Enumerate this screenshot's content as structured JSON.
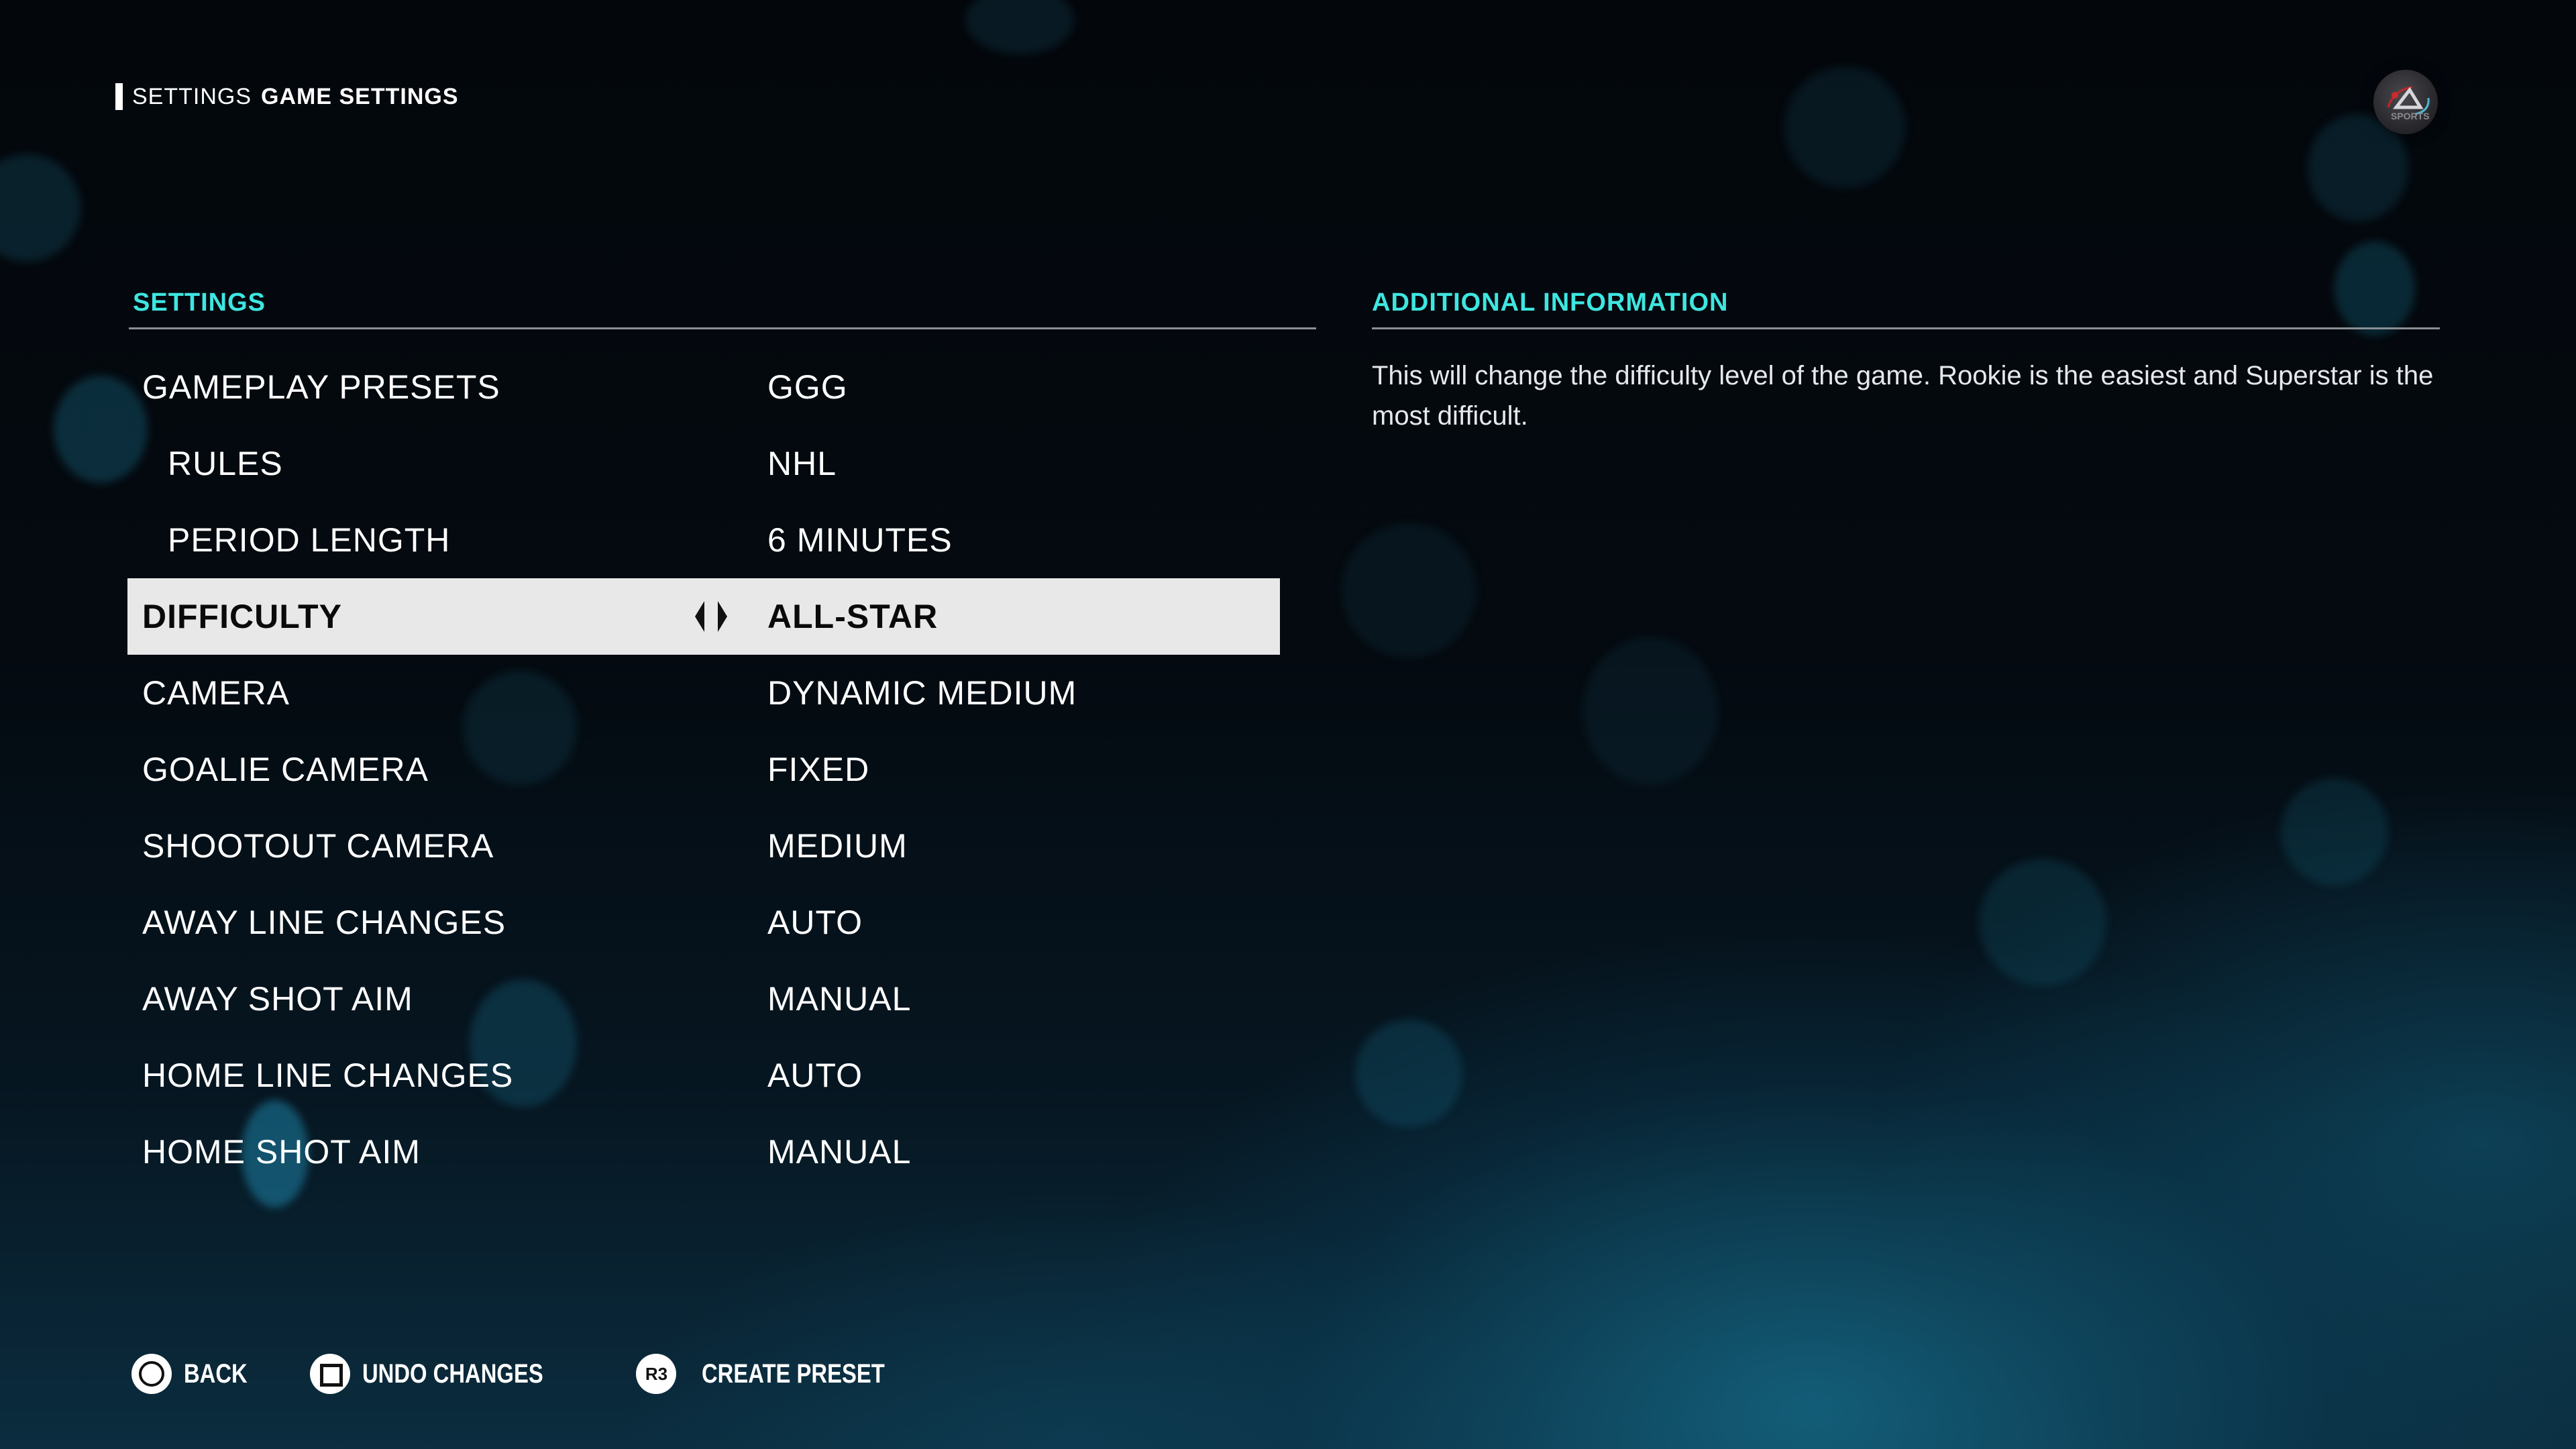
{
  "header": {
    "breadcrumb_parent": "SETTINGS",
    "breadcrumb_current": "GAME SETTINGS",
    "logo": "ea-sports-logo"
  },
  "settings_panel": {
    "heading": "SETTINGS",
    "rows": [
      {
        "label": "GAMEPLAY PRESETS",
        "value": "GGG",
        "indent": false,
        "selected": false
      },
      {
        "label": "RULES",
        "value": "NHL",
        "indent": true,
        "selected": false
      },
      {
        "label": "PERIOD LENGTH",
        "value": "6 MINUTES",
        "indent": true,
        "selected": false
      },
      {
        "label": "DIFFICULTY",
        "value": "ALL-STAR",
        "indent": false,
        "selected": true
      },
      {
        "label": "CAMERA",
        "value": "DYNAMIC MEDIUM",
        "indent": false,
        "selected": false
      },
      {
        "label": "GOALIE CAMERA",
        "value": "FIXED",
        "indent": false,
        "selected": false
      },
      {
        "label": "SHOOTOUT CAMERA",
        "value": "MEDIUM",
        "indent": false,
        "selected": false
      },
      {
        "label": "AWAY LINE CHANGES",
        "value": "AUTO",
        "indent": false,
        "selected": false
      },
      {
        "label": "AWAY SHOT AIM",
        "value": "MANUAL",
        "indent": false,
        "selected": false
      },
      {
        "label": "HOME LINE CHANGES",
        "value": "AUTO",
        "indent": false,
        "selected": false
      },
      {
        "label": "HOME SHOT AIM",
        "value": "MANUAL",
        "indent": false,
        "selected": false
      }
    ],
    "selector_icon": "left-right-arrows-icon"
  },
  "info_panel": {
    "heading": "ADDITIONAL INFORMATION",
    "text": "This will change the difficulty level of the game. Rookie is the easiest and Superstar is the most difficult."
  },
  "footer": {
    "hints": [
      {
        "button": "circle-button-icon",
        "label": "BACK"
      },
      {
        "button": "square-button-icon",
        "label": "UNDO CHANGES"
      },
      {
        "button": "r3-button-icon",
        "button_text": "R3",
        "label": "CREATE PRESET"
      }
    ]
  },
  "colors": {
    "accent": "#3ee6e0",
    "selected_row_bg": "#e8e8e8",
    "text": "#ffffff"
  }
}
